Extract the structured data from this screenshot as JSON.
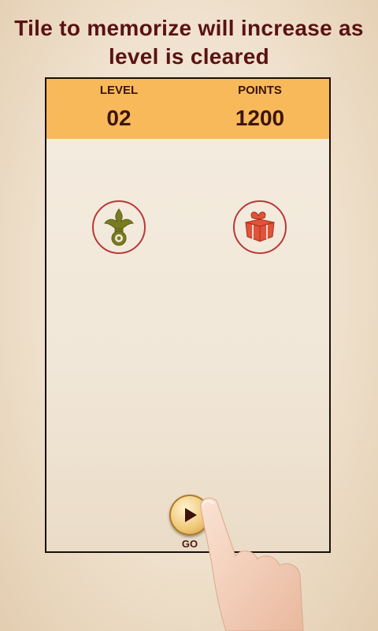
{
  "caption": {
    "line1": "Tile to memorize will increase as",
    "line2": "level is cleared"
  },
  "score": {
    "level_label": "LEVEL",
    "level_value": "02",
    "points_label": "POINTS",
    "points_value": "1200"
  },
  "tiles": [
    {
      "icon": "fleur-de-lis-icon",
      "color": "#7a7a22"
    },
    {
      "icon": "gift-box-icon",
      "color": "#e0533a"
    }
  ],
  "go": {
    "label": "GO",
    "icon": "play-icon"
  },
  "colors": {
    "caption": "#5a1212",
    "score_bar": "#f8b95b",
    "tile_ring": "#b9373a",
    "board_border": "#1a0f0a"
  }
}
